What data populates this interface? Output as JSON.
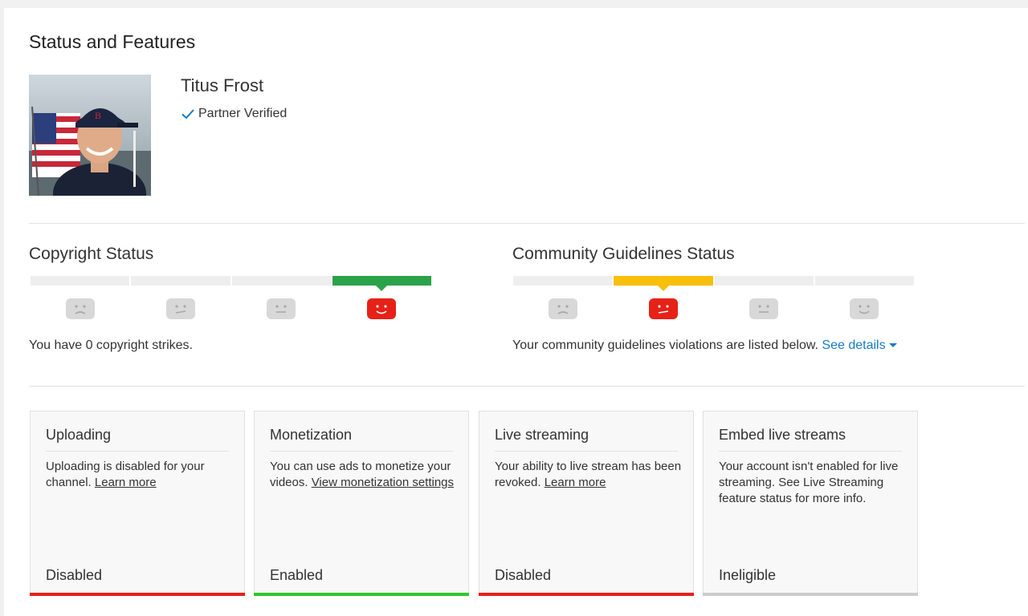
{
  "page": {
    "title": "Status and Features"
  },
  "channel": {
    "name": "Titus Frost",
    "verified_label": "Partner Verified"
  },
  "copyright": {
    "title": "Copyright Status",
    "text": "You have 0 copyright strikes.",
    "active_segment": 4,
    "segments": 4
  },
  "community": {
    "title": "Community Guidelines Status",
    "text": "Your community guidelines violations are listed below.",
    "link_label": "See details",
    "active_segment": 2,
    "segments": 4
  },
  "colors": {
    "green": "#2aa24a",
    "yellow": "#f8bf0b",
    "red": "#e62117",
    "enabled": "#2ec82a",
    "ineligible": "#cccccc",
    "link": "#167ac6"
  },
  "cards": [
    {
      "title": "Uploading",
      "desc": "Uploading is disabled for your channel. ",
      "link": "Learn more",
      "state": "Disabled"
    },
    {
      "title": "Monetization",
      "desc": "You can use ads to monetize your videos. ",
      "link": "View monetization settings",
      "state": "Enabled"
    },
    {
      "title": "Live streaming",
      "desc": "Your ability to live stream has been revoked. ",
      "link": "Learn more",
      "state": "Disabled"
    },
    {
      "title": "Embed live streams",
      "desc": "Your account isn't enabled for live streaming. See Live Streaming feature status for more info.",
      "link": "",
      "state": "Ineligible"
    }
  ]
}
